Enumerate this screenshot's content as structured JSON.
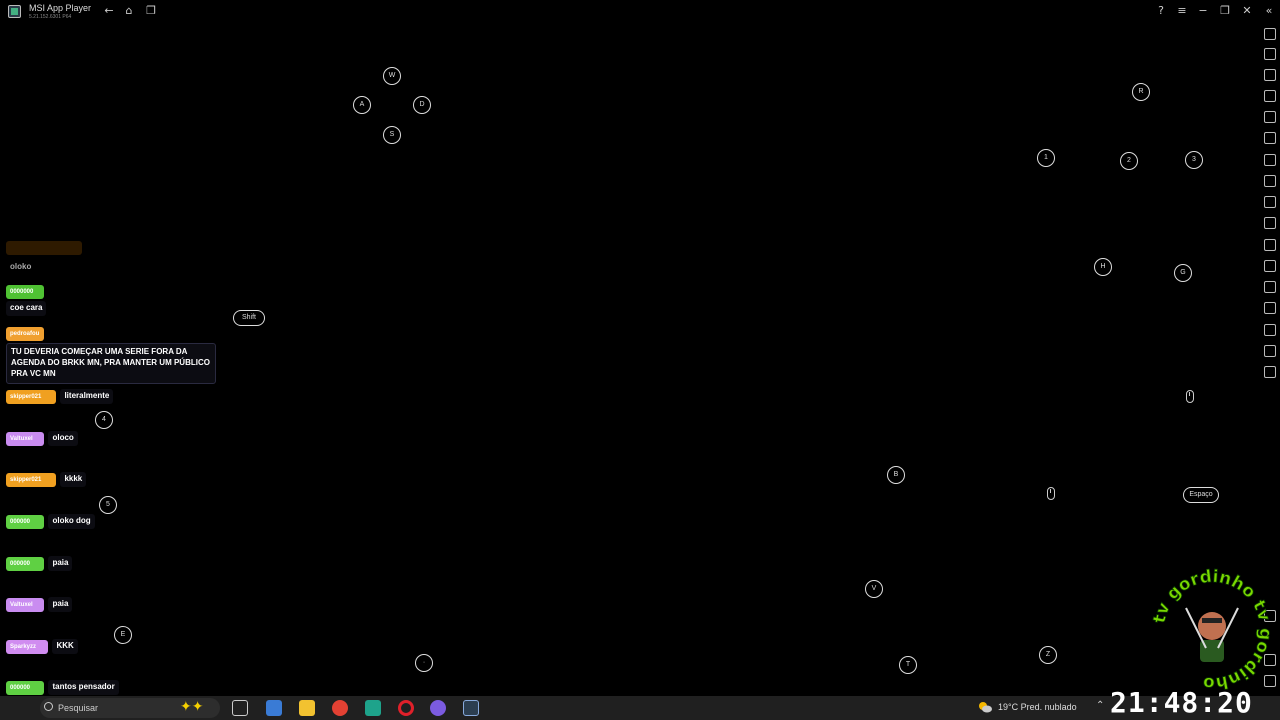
{
  "window": {
    "title": "MSI App Player",
    "version": "5.21.152.6301 P64"
  },
  "keys": {
    "w": "W",
    "a": "A",
    "s": "S",
    "d": "D",
    "r": "R",
    "k1": "1",
    "k2": "2",
    "k3": "3",
    "h": "H",
    "g": "G",
    "shift": "Shift",
    "k4": "4",
    "k5": "5",
    "b": "B",
    "space": "Espaço",
    "v": "V",
    "e": "E",
    "t": "T",
    "z": "Z",
    "dot": "·"
  },
  "chat": {
    "messages": [
      {
        "user": "",
        "text": "oloko",
        "color": "#6b3a00"
      },
      {
        "user": "0000000",
        "text": "coe cara",
        "color": "#4fc233"
      },
      {
        "user": "pedroafou",
        "text": "TU DEVERIA COMEÇAR UMA SERIE FORA DA AGENDA DO BRKK MN, PRA MANTER UM PÚBLICO PRA VC MN",
        "color": "#f0a030"
      },
      {
        "user": "skipper021",
        "text": "literalmente",
        "color": "#f0a020"
      },
      {
        "user": "Valtuxel",
        "text": "oloco",
        "color": "#c98cf0"
      },
      {
        "user": "skipper021",
        "text": "kkkk",
        "color": "#f0a020"
      },
      {
        "user": "000000",
        "text": "oloko dog",
        "color": "#5fd043"
      },
      {
        "user": "000000",
        "text": "paia",
        "color": "#5fd043"
      },
      {
        "user": "Valtuxel",
        "text": "paia",
        "color": "#c98cf0"
      },
      {
        "user": "Sparkyzz",
        "text": "KKK",
        "color": "#d08cf0"
      },
      {
        "user": "000000",
        "text": "tantos pensador",
        "color": "#5fd043"
      }
    ]
  },
  "taskbar": {
    "search_placeholder": "Pesquisar",
    "weather": "19°C  Pred. nublado",
    "clock": "21:48:20"
  },
  "overlay": {
    "logo_text": "tv gordinho"
  }
}
